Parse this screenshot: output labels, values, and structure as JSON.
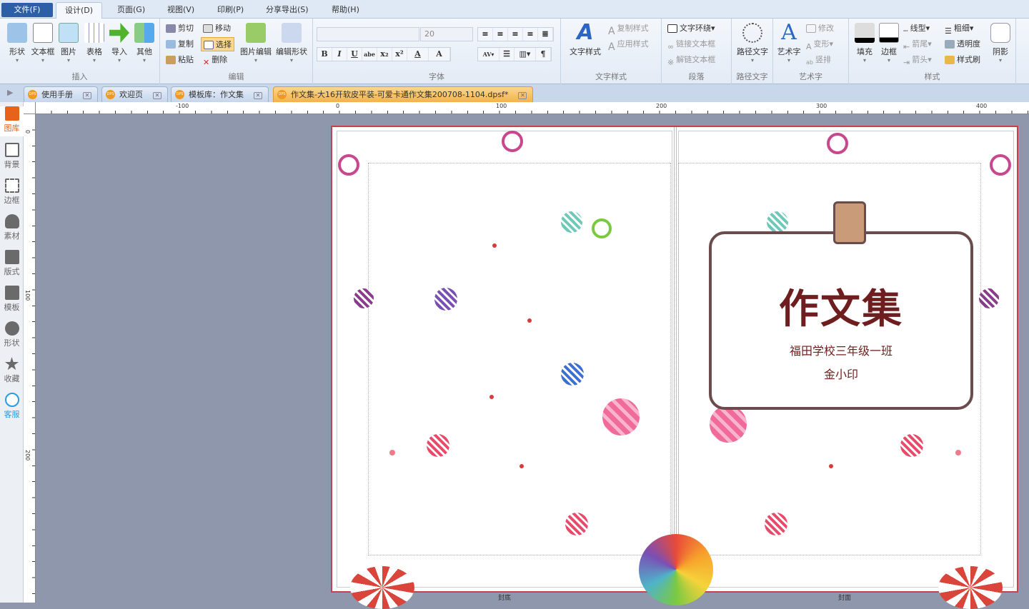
{
  "menu": {
    "file": "文件(F)",
    "items": [
      "设计(D)",
      "页面(G)",
      "视图(V)",
      "印刷(P)",
      "分享导出(S)",
      "帮助(H)"
    ]
  },
  "ribbon": {
    "insert": {
      "label": "插入",
      "items": [
        "形状",
        "文本框",
        "图片",
        "表格",
        "导入",
        "其他"
      ]
    },
    "edit": {
      "label": "编辑",
      "cut": "剪切",
      "move": "移动",
      "copy": "复制",
      "select": "选择",
      "paste": "粘贴",
      "delete": "删除",
      "image_edit": "图片编辑",
      "edit_shape": "编辑形状"
    },
    "font": {
      "label": "字体",
      "font_name": "",
      "font_size": "20",
      "format_buttons": [
        "B",
        "I",
        "U",
        "abe",
        "x₂",
        "x²",
        "A",
        "A"
      ]
    },
    "text_style": {
      "label": "文字样式",
      "big": "文字样式",
      "copy_style": "复制样式",
      "apply_style": "应用样式"
    },
    "paragraph": {
      "label": "段落",
      "wrap": "文字环绕",
      "link": "链接文本框",
      "unlink": "解链文本框"
    },
    "path_text": {
      "label": "路径文字",
      "big": "路径文字"
    },
    "art_text": {
      "label": "艺术字",
      "big": "艺术字",
      "modify": "修改",
      "transform": "变形",
      "vertical": "竖排"
    },
    "style": {
      "label": "样式",
      "fill": "填充",
      "border": "边框",
      "line_type": "线型",
      "thickness": "粗细",
      "arrow_tail": "箭尾",
      "transparency": "透明度",
      "arrow_head": "箭头",
      "format_brush": "样式刷",
      "shadow": "阴影"
    }
  },
  "tabs": [
    {
      "label": "使用手册"
    },
    {
      "label": "欢迎页"
    },
    {
      "label": "模板库：作文集"
    },
    {
      "label": "作文集-大16开软皮平装-可爱卡通作文集200708-1104.dpsf*",
      "active": true
    }
  ],
  "rulers": {
    "h": [
      "-100",
      "0",
      "100",
      "200",
      "300",
      "400"
    ],
    "v": [
      "0",
      "100",
      "200"
    ]
  },
  "sidebar": [
    "图库",
    "背景",
    "边框",
    "素材",
    "版式",
    "模板",
    "形状",
    "收藏",
    "客服"
  ],
  "document": {
    "title": "作文集",
    "school": "福田学校三年级一班",
    "name": "金小印",
    "back_label": "封底",
    "front_label": "封面"
  },
  "colors": {
    "accent": "#f09820",
    "title": "#6e1e1e",
    "border": "#c94050"
  }
}
